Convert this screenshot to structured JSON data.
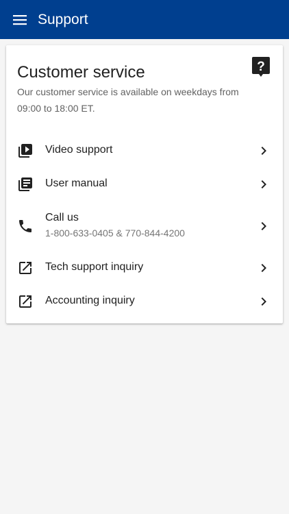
{
  "app_bar": {
    "title": "Support",
    "menu_icon": "menu-icon",
    "background_color": "#003f8f"
  },
  "card": {
    "title": "Customer service",
    "description": "Our customer service is available on weekdays from 09:00 to 18:00 ET.",
    "help_icon": "help-icon",
    "items": [
      {
        "icon": "video-library-icon",
        "label": "Video support"
      },
      {
        "icon": "library-books-icon",
        "label": "User manual"
      },
      {
        "icon": "phone-icon",
        "label": "Call us",
        "sublabel": "1-800-633-0405 & 770-844-4200"
      },
      {
        "icon": "open-in-new-icon",
        "label": "Tech support inquiry"
      },
      {
        "icon": "open-in-new-icon",
        "label": "Accounting inquiry"
      }
    ]
  }
}
